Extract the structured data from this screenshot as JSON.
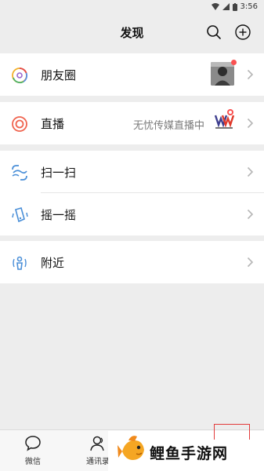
{
  "status": {
    "time": "3:56"
  },
  "header": {
    "title": "发现"
  },
  "sections": {
    "moments": {
      "label": "朋友圈"
    },
    "live": {
      "label": "直播",
      "extra": "无忧传媒直播中"
    },
    "scan": {
      "label": "扫一扫"
    },
    "shake": {
      "label": "摇一摇"
    },
    "nearby": {
      "label": "附近"
    }
  },
  "tabbar": {
    "tabs": [
      {
        "label": "微信"
      },
      {
        "label": "通讯录"
      }
    ]
  },
  "watermark": {
    "text": "鲤鱼手游网"
  },
  "colors": {
    "accent_red": "#fa5151",
    "background": "#ededed",
    "highlight_box": "#e23b3b"
  },
  "icons": [
    "search-icon",
    "add-icon",
    "moments-icon",
    "live-icon",
    "scan-icon",
    "shake-icon",
    "nearby-icon",
    "chevron-right-icon",
    "chat-icon",
    "contacts-icon"
  ]
}
